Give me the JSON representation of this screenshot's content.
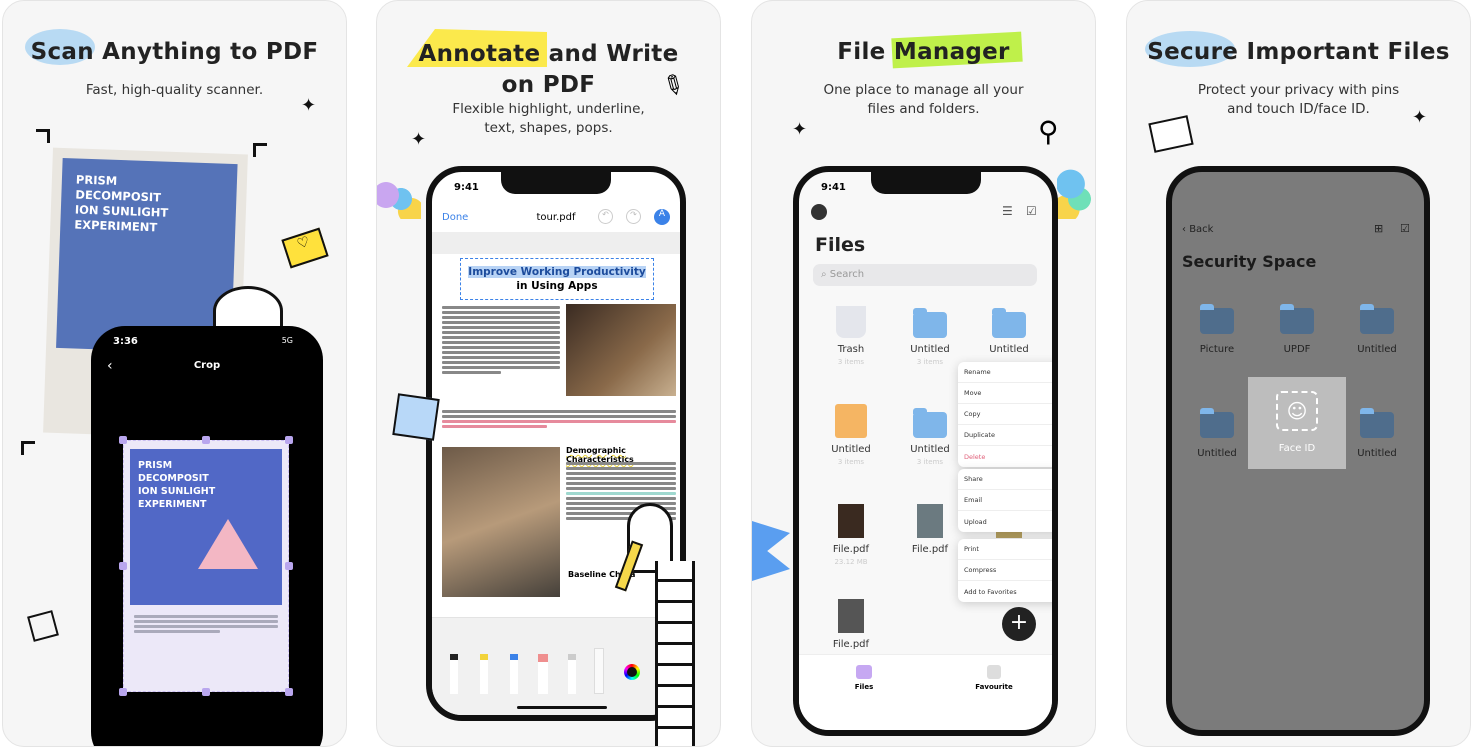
{
  "panels": [
    {
      "title_highlight": "Scan",
      "title_rest": " Anything to PDF",
      "subtitle": "Fast, high-quality scanner.",
      "highlight_color": "#a9d3f2",
      "paper": {
        "heading_lines": [
          "PRISM",
          "DECOMPOSIT",
          "ION SUNLIGHT",
          "EXPERIMENT"
        ]
      },
      "phone": {
        "time": "3:36",
        "network": "5G",
        "screen_title": "Crop",
        "back_icon": "chevron-left-icon",
        "doc_heading_lines": [
          "PRISM",
          "DECOMPOSIT",
          "ION SUNLIGHT",
          "EXPERIMENT"
        ]
      }
    },
    {
      "title_highlight": "Annotate",
      "title_rest": " and Write",
      "title_line2": "on PDF",
      "subtitle_lines": [
        "Flexible highlight, underline,",
        "text, shapes, pops."
      ],
      "highlight_color": "#fbe94c",
      "phone": {
        "time": "9:41",
        "done": "Done",
        "file_name": "tour.pdf",
        "doc_title_highlight": "Improve Working Productivity",
        "doc_title_line2": "in Using Apps",
        "section1": "Demographic Characteristics",
        "section2": "Baseline Chara",
        "tools": [
          "pen",
          "highlighter",
          "marker",
          "eraser",
          "pencil",
          "ruler",
          "color-picker"
        ]
      }
    },
    {
      "title_plain": "File ",
      "title_highlight": "Manager",
      "subtitle_lines": [
        "One place to manage all your",
        "files and folders."
      ],
      "highlight_color": "#bff04a",
      "phone": {
        "time": "9:41",
        "screen_title": "Files",
        "search_placeholder": "Search",
        "items": [
          {
            "name": "Trash",
            "meta": "3 items",
            "kind": "trash"
          },
          {
            "name": "Untitled",
            "meta": "3 items",
            "kind": "folder"
          },
          {
            "name": "Untitled",
            "meta": "",
            "kind": "folder"
          },
          {
            "name": "Untitled",
            "meta": "3 items",
            "kind": "zip"
          },
          {
            "name": "Untitled",
            "meta": "3 items",
            "kind": "folder"
          },
          {
            "name": "File.pdf",
            "meta": "23.12 MB",
            "kind": "pdf",
            "color": "#f0b5c8"
          },
          {
            "name": "File.pdf",
            "meta": "23.12 MB",
            "kind": "pdf",
            "color": "#3a2a20"
          },
          {
            "name": "File.pdf",
            "meta": "",
            "kind": "pdf",
            "color": "#6b7a80"
          },
          {
            "name": "File.pdf",
            "meta": "",
            "kind": "pdf",
            "color": "#b5a060"
          },
          {
            "name": "File.pdf",
            "meta": "",
            "kind": "pdf",
            "color": "#555"
          }
        ],
        "menu_groups": [
          [
            {
              "label": "Rename",
              "icon": "✎"
            },
            {
              "label": "Move",
              "icon": "▭"
            },
            {
              "label": "Copy",
              "icon": "⧉"
            },
            {
              "label": "Duplicate",
              "icon": "⧉"
            },
            {
              "label": "Delete",
              "icon": "🗑",
              "danger": true
            }
          ],
          [
            {
              "label": "Share",
              "icon": "↗"
            },
            {
              "label": "Email",
              "icon": "✉"
            },
            {
              "label": "Upload",
              "icon": "⇪"
            }
          ],
          [
            {
              "label": "Print",
              "icon": "⊜"
            },
            {
              "label": "Compress",
              "icon": "▣"
            },
            {
              "label": "Add to Favorites",
              "icon": "☆"
            }
          ]
        ],
        "fab": "+",
        "tabs": [
          {
            "label": "Files"
          },
          {
            "label": "Favourite"
          }
        ]
      }
    },
    {
      "title_highlight": "Secure",
      "title_rest": " Important Files",
      "subtitle_lines": [
        "Protect your privacy with pins",
        "and touch ID/face ID."
      ],
      "highlight_color": "#a9d3f2",
      "phone": {
        "back": "Back",
        "screen_title": "Security Space",
        "folders": [
          "Picture",
          "UPDF",
          "Untitled",
          "Untitled",
          "Untitled",
          "Untitled"
        ],
        "face_id_label": "Face ID"
      }
    }
  ]
}
